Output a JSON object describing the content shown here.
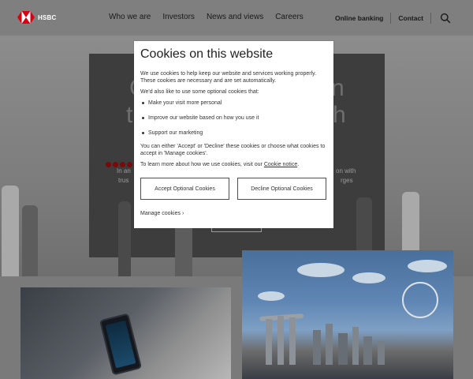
{
  "brand": {
    "name": "HSBC",
    "logo_color": "#db0011"
  },
  "nav": {
    "items": [
      "Who we are",
      "Investors",
      "News and views",
      "Careers"
    ],
    "online_banking": "Online banking",
    "contact": "Contact",
    "search_icon": "search-icon"
  },
  "hero": {
    "line1": "C",
    "line1_tail": "n",
    "line2": "t",
    "line2_tail": "h",
    "text1_start": "In an",
    "text1_end": "on with",
    "text2_start": "trus",
    "text2_end": "rges"
  },
  "cookie_modal": {
    "title": "Cookies on this website",
    "intro": "We use cookies to help keep our website and services working properly. These cookies are necessary and are set automatically.",
    "optional_intro": "We'd also like to use some optional cookies that:",
    "bullets": [
      "Make your visit more personal",
      "Improve our website based on how you use it",
      "Support our marketing"
    ],
    "choose_text": "You can either 'Accept' or 'Decline' these cookies or choose what cookies to accept in 'Manage cookies'.",
    "learn_prefix": "To learn more about how we use cookies, visit our ",
    "learn_link": "Cookie notice",
    "learn_suffix": ".",
    "accept_label": "Accept Optional Cookies",
    "decline_label": "Decline Optional Cookies",
    "manage_label": "Manage cookies",
    "manage_chevron": "›"
  },
  "colors": {
    "header_bg": "#7f7f7f",
    "modal_bg": "#ffffff",
    "text": "#333333"
  }
}
